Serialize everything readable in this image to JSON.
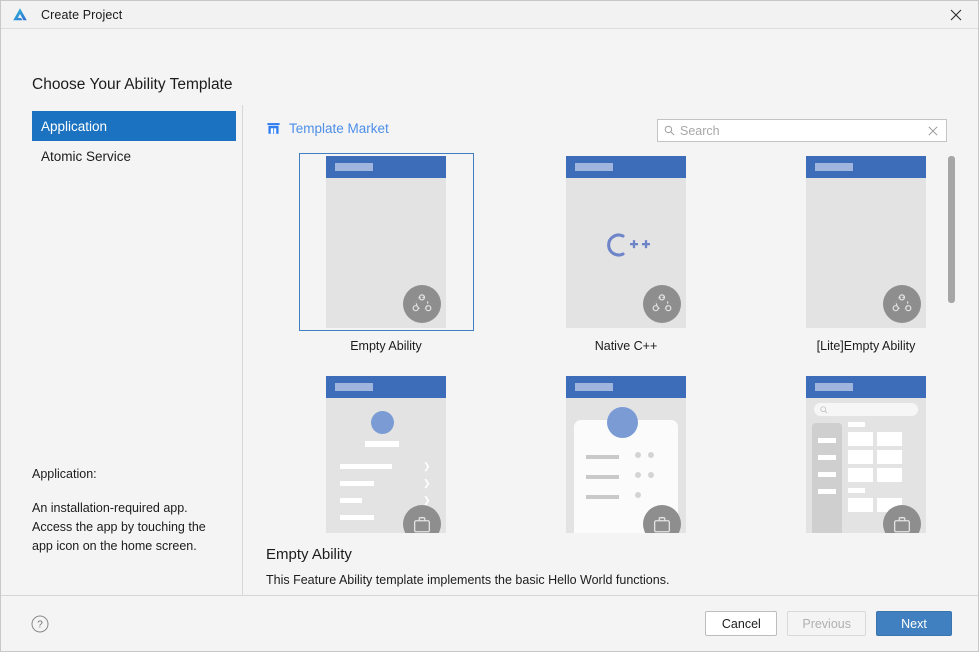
{
  "window": {
    "title": "Create Project",
    "logo_icon": "deveco-logo-icon",
    "close_icon": "close-icon"
  },
  "heading": "Choose Your Ability Template",
  "sidebar": {
    "items": [
      {
        "label": "Application",
        "selected": true
      },
      {
        "label": "Atomic Service",
        "selected": false
      }
    ],
    "description": {
      "title": "Application:",
      "body": "An installation-required app. Access the app by touching the app icon on the home screen."
    }
  },
  "toolbar": {
    "market_label": "Template Market",
    "market_icon": "store-icon",
    "search": {
      "placeholder": "Search",
      "value": "",
      "search_icon": "search-icon",
      "clear_icon": "clear-icon"
    }
  },
  "templates": [
    {
      "label": "Empty Ability",
      "art": "plain",
      "selected": true,
      "badge_icon": "distributed-icon"
    },
    {
      "label": "Native C++",
      "art": "cpp",
      "selected": false,
      "badge_icon": "distributed-icon",
      "art_text": "C++"
    },
    {
      "label": "[Lite]Empty Ability",
      "art": "plain",
      "selected": false,
      "badge_icon": "distributed-icon"
    },
    {
      "label": "",
      "art": "list",
      "selected": false,
      "badge_icon": "suitcase-icon"
    },
    {
      "label": "",
      "art": "card",
      "selected": false,
      "badge_icon": "suitcase-icon"
    },
    {
      "label": "",
      "art": "grid",
      "selected": false,
      "badge_icon": "suitcase-icon"
    }
  ],
  "selected_template": {
    "title": "Empty Ability",
    "description": "This Feature Ability template implements the basic Hello World functions."
  },
  "scrollbar": {
    "thumb_top_pct": 1,
    "thumb_height_pct": 39
  },
  "footer": {
    "help_icon": "help-circle-icon",
    "buttons": [
      {
        "label": "Cancel",
        "style": "default"
      },
      {
        "label": "Previous",
        "style": "disabled"
      },
      {
        "label": "Next",
        "style": "primary"
      }
    ]
  },
  "colors": {
    "accent_blue": "#1a72c0",
    "primary_button": "#4180c0",
    "link_blue": "#4d8fe8",
    "thumb_topbar": "#3d6cb9",
    "selection_border": "#3f7fc1"
  }
}
